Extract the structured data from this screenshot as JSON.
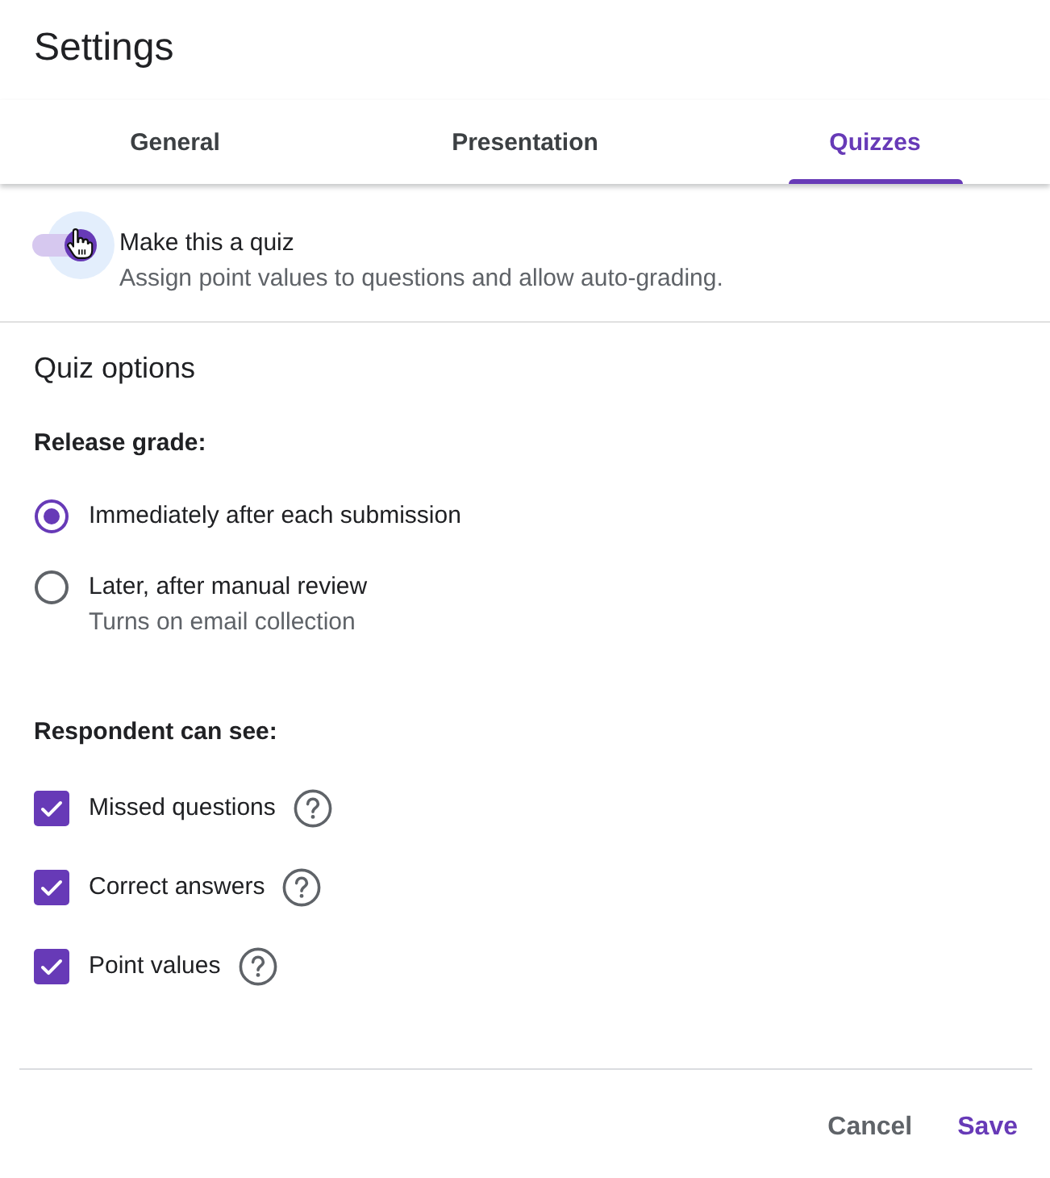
{
  "dialog": {
    "title": "Settings"
  },
  "tabs": [
    {
      "label": "General",
      "selected": false
    },
    {
      "label": "Presentation",
      "selected": false
    },
    {
      "label": "Quizzes",
      "selected": true
    }
  ],
  "quiz_toggle": {
    "label": "Make this a quiz",
    "description": "Assign point values to questions and allow auto-grading.",
    "on": true
  },
  "quiz_options": {
    "heading": "Quiz options",
    "release_grade": {
      "label": "Release grade:",
      "options": [
        {
          "label": "Immediately after each submission",
          "selected": true
        },
        {
          "label": "Later, after manual review",
          "note": "Turns on email collection",
          "selected": false
        }
      ]
    },
    "respondent_can_see": {
      "label": "Respondent can see:",
      "options": [
        {
          "label": "Missed questions",
          "checked": true
        },
        {
          "label": "Correct answers",
          "checked": true
        },
        {
          "label": "Point values",
          "checked": true
        }
      ]
    }
  },
  "buttons": [
    {
      "label": "Cancel",
      "kind": "secondary"
    },
    {
      "label": "Save",
      "kind": "primary"
    }
  ]
}
